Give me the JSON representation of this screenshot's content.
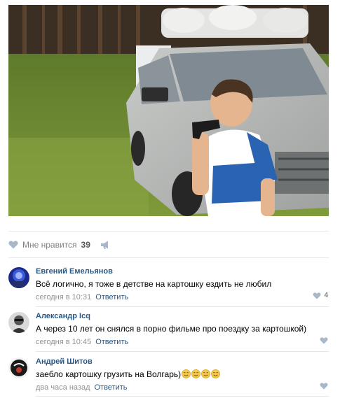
{
  "post": {
    "likes_label": "Мне нравится",
    "likes_count": "39"
  },
  "comments": [
    {
      "author": "Евгений Емельянов",
      "text": "Всё логично, я тоже в детстве на картошку ездить не любил",
      "time": "сегодня в 10:31",
      "reply": "Ответить",
      "likes": "4"
    },
    {
      "author": "Александр Icq",
      "text": "А через 10 лет он снялся в порно фильме про поездку за картошкой)",
      "time": "сегодня в 10:45",
      "reply": "Ответить"
    },
    {
      "author": "Андрей Шитов",
      "text": "заебло картошку грузить на Волгарь)",
      "time": "два часа назад",
      "reply": "Ответить",
      "emoji_count": 4
    }
  ],
  "colors": {
    "link": "#2a5885",
    "meta": "#939393",
    "divider": "#e7e8ec"
  }
}
